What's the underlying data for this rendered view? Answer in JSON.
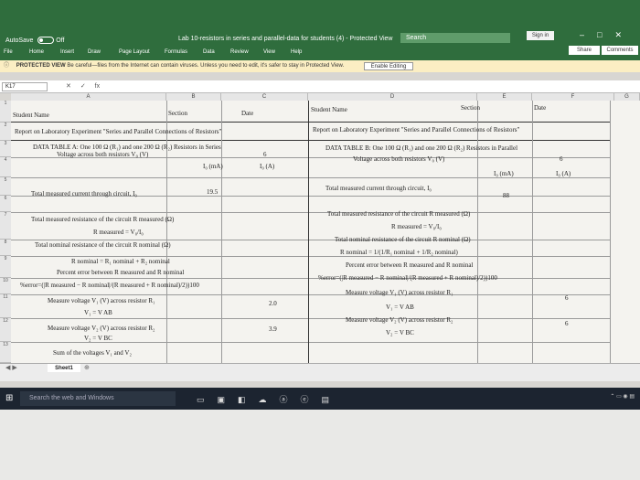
{
  "title_bar": {
    "autosave_label": "AutoSave",
    "autosave_state": "Off",
    "doc_title": "Lab 10-resistors in series and parallel-data for students (4)  -  Protected View",
    "search_label": "Search",
    "sign_in": "Sign in"
  },
  "ribbon": {
    "tabs": [
      "File",
      "Home",
      "Insert",
      "Draw",
      "Page Layout",
      "Formulas",
      "Data",
      "Review",
      "View",
      "Help"
    ],
    "share": "Share",
    "comments": "Comments"
  },
  "protected_bar": {
    "label": "PROTECTED VIEW",
    "message": "Be careful—files from the Internet can contain viruses. Unless you need to edit, it's safer to stay in Protected View.",
    "enable_button": "Enable Editing"
  },
  "formula_bar": {
    "name_box": "K17",
    "fx": "fx"
  },
  "columns": [
    "A",
    "B",
    "C",
    "D",
    "E",
    "F",
    "G"
  ],
  "rows": [
    "1",
    "2",
    "3",
    "4",
    "5",
    "6",
    "7",
    "8",
    "9",
    "10",
    "11",
    "12",
    "13"
  ],
  "left_table": {
    "student_name": "Student Name",
    "section": "Section",
    "date": "Date",
    "report_title": "Report on Laboratory Experiment \"Series and Parallel Connections of Resistors\"",
    "table_title": "DATA TABLE A: One 100 Ω (R₁) and one 200 Ω (R₂) Resistors in Series",
    "voltage_label": "Voltage across both resistors  V₀ (V)",
    "voltage_value": "6",
    "i_ma_header": "I₀ (mA)",
    "i_a_header": "I₀ (A)",
    "current_label": "Total measured current through circuit, I₀",
    "current_value": "19.5",
    "measured_res_label": "Total measured resistance of the circuit R measured (Ω)",
    "measured_res_formula": "R measured = V₀/I₀",
    "nominal_res_label": "Total nominal resistance of the circuit R nominal (Ω)",
    "nominal_res_formula": "R nominal = R₁ nominal + R₂ nominal",
    "percent_error_label": "Percent error between R measured and R nominal",
    "percent_error_formula": "%error=(|R measured − R nominal|/(R measured + R nominal)/2))100",
    "v1_label": "Measure voltage V₁ (V) across resistor R₁",
    "v1_formula": "V₁ = V AB",
    "v1_value": "2.0",
    "v2_label": "Measure voltage V₂ (V) across resistor R₂",
    "v2_formula": "V₂ = V BC",
    "v2_value": "3.9",
    "sum_label": "Sum of the voltages V₁ and V₂"
  },
  "right_table": {
    "student_name": "Student Name",
    "section": "Section",
    "date": "Date",
    "report_title": "Report on Laboratory Experiment \"Series and Parallel Connections of Resistors\"",
    "table_title": "DATA TABLE B: One 100 Ω (R₁) and one 200 Ω (R₂) Resistors in Parallel",
    "voltage_label": "Voltage across both resistors  V₀ (V)",
    "voltage_value": "6",
    "i_ma_header": "I₀ (mA)",
    "i_a_header": "I₀ (A)",
    "current_label": "Total measured current through circuit, I₀",
    "current_value": "88",
    "measured_res_label": "Total measured resistance of the circuit R measured (Ω)",
    "measured_res_formula": "R measured = V₀/I₀",
    "nominal_res_label": "Total nominal resistance of the circuit R nominal (Ω)",
    "nominal_res_formula": "R nominal = 1/(1/R₁ nominal + 1/R₂ nominal)",
    "percent_error_label": "Percent error between R measured and R nominal",
    "percent_error_formula": "%error=(|R measured − R nominal|/(R measured + R nominal)/2))100",
    "v1_label": "Measure voltage V₁ (V) across resistor R₁",
    "v1_formula": "V₁ = V AB",
    "v1_value": "6",
    "v2_label": "Measure voltage V₂ (V) across resistor R₂",
    "v2_formula": "V₂ = V BC",
    "v2_value": "6"
  },
  "sheet_tab": "Sheet1",
  "taskbar": {
    "search_placeholder": "Search the web and Windows"
  }
}
